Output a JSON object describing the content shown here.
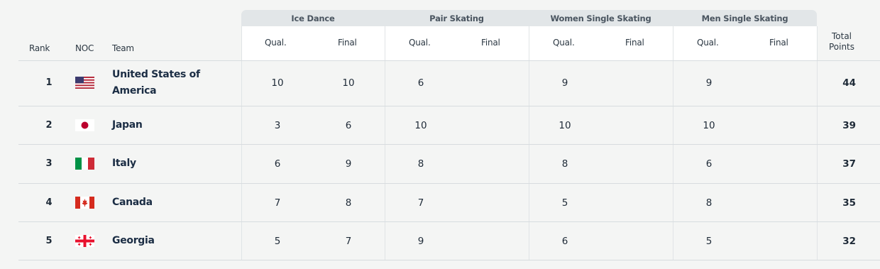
{
  "columns": {
    "rank": "Rank",
    "noc": "NOC",
    "team": "Team",
    "qual": "Qual.",
    "final": "Final",
    "total": "Total Points"
  },
  "sports": [
    "Ice Dance",
    "Pair Skating",
    "Women Single Skating",
    "Men Single Skating"
  ],
  "rows": [
    {
      "rank": "1",
      "team": "United States of America",
      "flag": "flag-usa-icon",
      "ice_qual": "10",
      "ice_final": "10",
      "pair_qual": "6",
      "pair_final": "",
      "women_qual": "9",
      "women_final": "",
      "men_qual": "9",
      "men_final": "",
      "total": "44"
    },
    {
      "rank": "2",
      "team": "Japan",
      "flag": "flag-japan-icon",
      "ice_qual": "3",
      "ice_final": "6",
      "pair_qual": "10",
      "pair_final": "",
      "women_qual": "10",
      "women_final": "",
      "men_qual": "10",
      "men_final": "",
      "total": "39"
    },
    {
      "rank": "3",
      "team": "Italy",
      "flag": "flag-italy-icon",
      "ice_qual": "6",
      "ice_final": "9",
      "pair_qual": "8",
      "pair_final": "",
      "women_qual": "8",
      "women_final": "",
      "men_qual": "6",
      "men_final": "",
      "total": "37"
    },
    {
      "rank": "4",
      "team": "Canada",
      "flag": "flag-canada-icon",
      "ice_qual": "7",
      "ice_final": "8",
      "pair_qual": "7",
      "pair_final": "",
      "women_qual": "5",
      "women_final": "",
      "men_qual": "8",
      "men_final": "",
      "total": "35"
    },
    {
      "rank": "5",
      "team": "Georgia",
      "flag": "flag-georgia-icon",
      "ice_qual": "5",
      "ice_final": "7",
      "pair_qual": "9",
      "pair_final": "",
      "women_qual": "6",
      "women_final": "",
      "men_qual": "5",
      "men_final": "",
      "total": "32"
    }
  ],
  "colors": {
    "header_bg": "#e2e6e8",
    "header_band": "#ffffff",
    "page_bg": "#f4f5f4",
    "text": "#1f2b38"
  }
}
